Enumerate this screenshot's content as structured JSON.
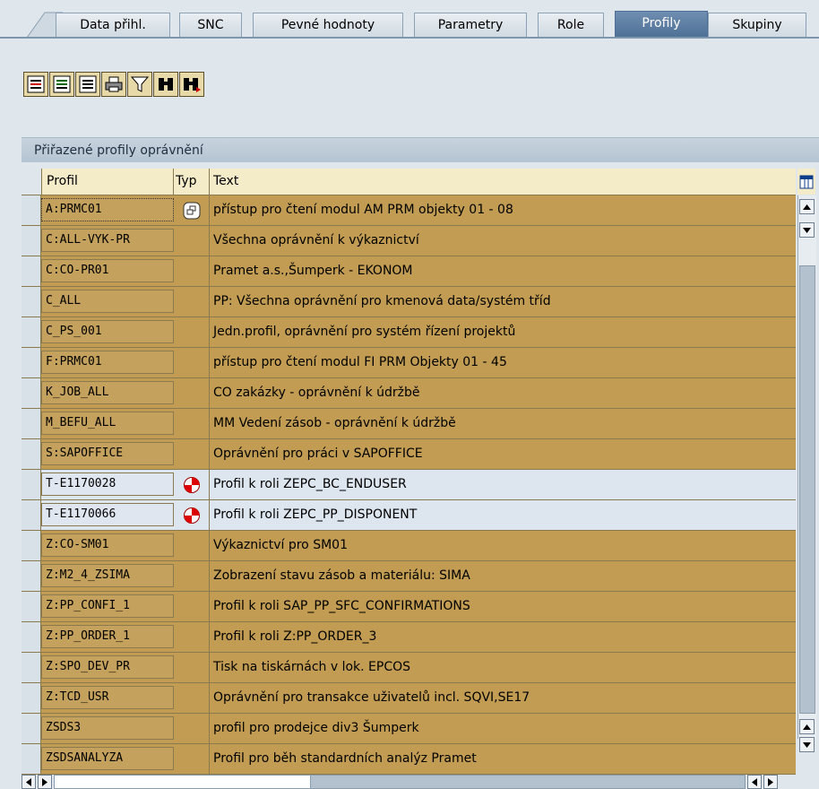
{
  "tabs": [
    {
      "label": "Data přihl.",
      "selected": false
    },
    {
      "label": "SNC",
      "selected": false
    },
    {
      "label": "Pevné hodnoty",
      "selected": false
    },
    {
      "label": "Parametry",
      "selected": false
    },
    {
      "label": "Role",
      "selected": false
    },
    {
      "label": "Profily",
      "selected": true
    },
    {
      "label": "Skupiny",
      "selected": false
    }
  ],
  "toolbar": {
    "icons": [
      "select-all-icon",
      "select-block-icon",
      "deselect-all-icon",
      "print-icon",
      "filter-icon",
      "find-icon",
      "find-next-icon"
    ]
  },
  "group": {
    "title": "Přiřazené profily oprávnění"
  },
  "table": {
    "headers": {
      "profil": "Profil",
      "typ": "Typ",
      "text": "Text"
    },
    "rows": [
      {
        "profil": "A:PRMC01",
        "typ": "composite-profile-icon",
        "text": "přístup pro čtení modul AM PRM objekty 01 - 08",
        "alt": false
      },
      {
        "profil": "C:ALL-VYK-PR",
        "typ": "",
        "text": "Všechna oprávnění k výkaznictví",
        "alt": false
      },
      {
        "profil": "C:CO-PR01",
        "typ": "",
        "text": "Pramet a.s.,Šumperk - EKONOM",
        "alt": false
      },
      {
        "profil": "C_ALL",
        "typ": "",
        "text": "PP: Všechna oprávnění pro kmenová data/systém tříd",
        "alt": false
      },
      {
        "profil": "C_PS_001",
        "typ": "",
        "text": "Jedn.profil, oprávnění pro systém řízení projektů",
        "alt": false
      },
      {
        "profil": "F:PRMC01",
        "typ": "",
        "text": "přístup pro čtení modul FI PRM Objekty 01 - 45",
        "alt": false
      },
      {
        "profil": "K_JOB_ALL",
        "typ": "",
        "text": "CO zakázky - oprávnění k údržbě",
        "alt": false
      },
      {
        "profil": "M_BEFU_ALL",
        "typ": "",
        "text": "MM Vedení zásob - oprávnění k údržbě",
        "alt": false
      },
      {
        "profil": "S:SAPOFFICE",
        "typ": "",
        "text": "Oprávnění pro práci v SAPOFFICE",
        "alt": false
      },
      {
        "profil": "T-E1170028",
        "typ": "generated-profile-icon",
        "text": "Profil k roli ZEPC_BC_ENDUSER",
        "alt": true
      },
      {
        "profil": "T-E1170066",
        "typ": "generated-profile-icon",
        "text": "Profil k roli ZEPC_PP_DISPONENT",
        "alt": true
      },
      {
        "profil": "Z:CO-SM01",
        "typ": "",
        "text": "Výkaznictví pro SM01",
        "alt": false
      },
      {
        "profil": "Z:M2_4_ZSIMA",
        "typ": "",
        "text": "Zobrazení stavu zásob a materiálu: SIMA",
        "alt": false
      },
      {
        "profil": "Z:PP_CONFI_1",
        "typ": "",
        "text": "Profil k roli SAP_PP_SFC_CONFIRMATIONS",
        "alt": false
      },
      {
        "profil": "Z:PP_ORDER_1",
        "typ": "",
        "text": "Profil k roli Z:PP_ORDER_3",
        "alt": false
      },
      {
        "profil": "Z:SPO_DEV_PR",
        "typ": "",
        "text": "Tisk na tiskárnách v lok. EPCOS",
        "alt": false
      },
      {
        "profil": "Z:TCD_USR",
        "typ": "",
        "text": "Oprávnění pro transakce uživatelů incl. SQVI,SE17",
        "alt": false
      },
      {
        "profil": "ZSDS3",
        "typ": "",
        "text": "profil pro prodejce div3 Šumperk",
        "alt": false
      },
      {
        "profil": "ZSDSANALYZA",
        "typ": "",
        "text": "Profil pro běh standardních analýz Pramet",
        "alt": false
      }
    ]
  },
  "colors": {
    "row": "#c19c52",
    "row_alt": "#dde5ee",
    "tab_selected": "#4d6f95"
  }
}
